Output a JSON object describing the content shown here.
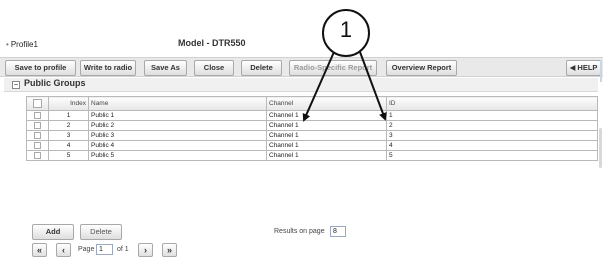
{
  "header": {
    "profile_bullet": "•",
    "profile_name": "Profile1",
    "model_title": "Model - DTR550"
  },
  "callout": {
    "label": "1"
  },
  "toolbar": {
    "save_to_profile": "Save to profile",
    "write_to_radio": "Write to radio",
    "save_as": "Save As",
    "close": "Close",
    "delete": "Delete",
    "radio_specific_report": "Radio-Specific Report",
    "overview_report": "Overview Report",
    "help": "◀ HELP"
  },
  "section": {
    "collapse_glyph": "−",
    "title": "Public Groups"
  },
  "table": {
    "columns": {
      "index": "Index",
      "name": "Name",
      "channel": "Channel",
      "id": "ID"
    },
    "rows": [
      {
        "index": "1",
        "name": "Public 1",
        "channel": "Channel 1",
        "id": "1"
      },
      {
        "index": "2",
        "name": "Public 2",
        "channel": "Channel 1",
        "id": "2"
      },
      {
        "index": "3",
        "name": "Public 3",
        "channel": "Channel 1",
        "id": "3"
      },
      {
        "index": "4",
        "name": "Public 4",
        "channel": "Channel 1",
        "id": "4"
      },
      {
        "index": "5",
        "name": "Public 5",
        "channel": "Channel 1",
        "id": "5"
      }
    ]
  },
  "footer": {
    "add": "Add",
    "delete": "Delete",
    "results_label": "Results on page",
    "results_value": "8",
    "first_page": "«",
    "prev_page": "‹",
    "page_label": "Page",
    "page_value": "1",
    "of_label": "of 1",
    "next_page": "›",
    "last_page": "»"
  }
}
